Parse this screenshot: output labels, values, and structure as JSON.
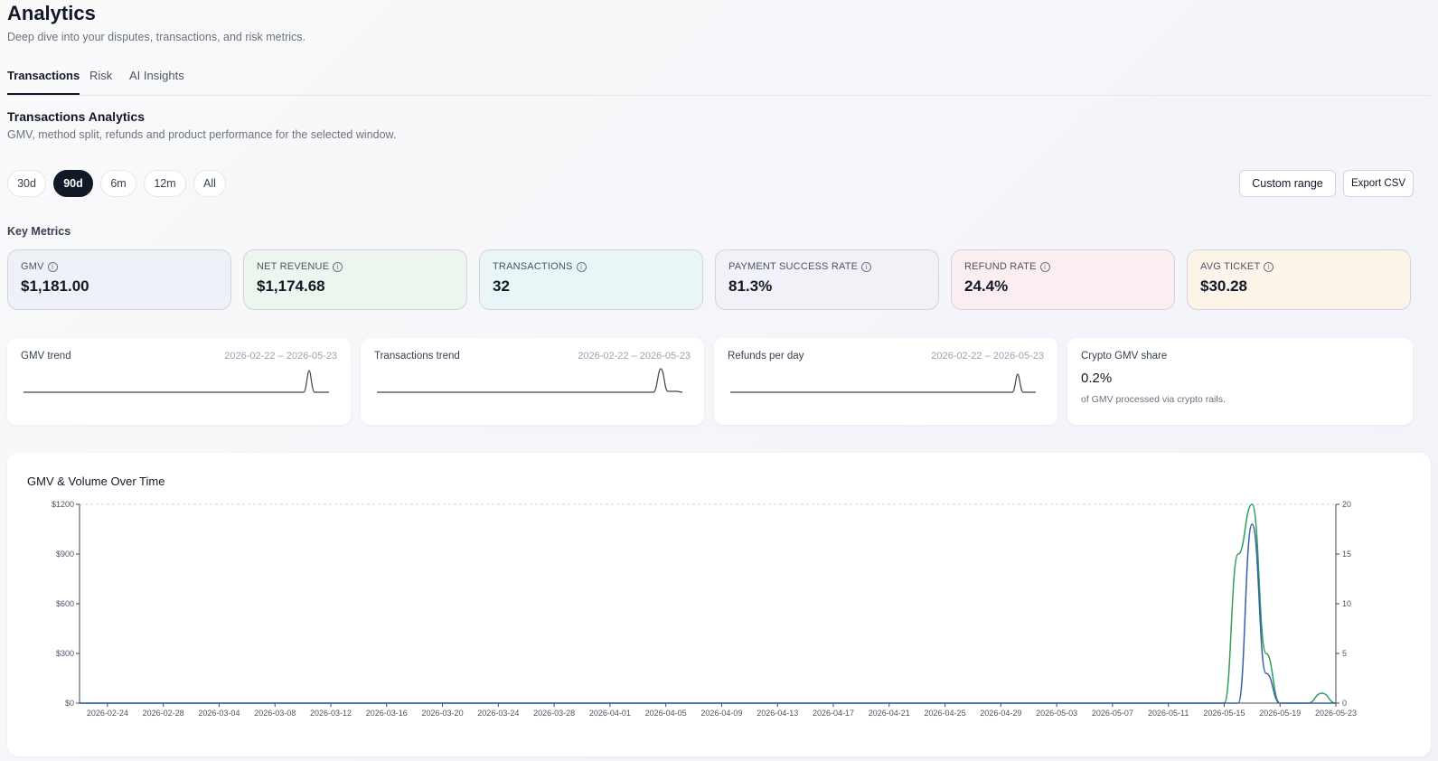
{
  "header": {
    "title": "Analytics",
    "subtitle": "Deep dive into your disputes, transactions, and risk metrics."
  },
  "tabs": [
    {
      "label": "Transactions",
      "active": true
    },
    {
      "label": "Risk",
      "active": false
    },
    {
      "label": "AI Insights",
      "active": false
    }
  ],
  "section": {
    "title": "Transactions Analytics",
    "subtitle": "GMV, method split, refunds and product performance for the selected window."
  },
  "ranges": [
    {
      "label": "30d",
      "active": false
    },
    {
      "label": "90d",
      "active": true
    },
    {
      "label": "6m",
      "active": false
    },
    {
      "label": "12m",
      "active": false
    },
    {
      "label": "All",
      "active": false
    }
  ],
  "actions": {
    "custom_range": "Custom range",
    "export_csv": "Export CSV"
  },
  "key_metrics": {
    "title": "Key Metrics",
    "items": [
      {
        "label": "GMV",
        "value": "$1,181.00",
        "bg": "#eef1f7"
      },
      {
        "label": "NET REVENUE",
        "value": "$1,174.68",
        "bg": "#edf5ef"
      },
      {
        "label": "TRANSACTIONS",
        "value": "32",
        "bg": "#eaf5f7"
      },
      {
        "label": "PAYMENT SUCCESS RATE",
        "value": "81.3%",
        "bg": "#f2f1f8"
      },
      {
        "label": "REFUND RATE",
        "value": "24.4%",
        "bg": "#fbeef1"
      },
      {
        "label": "AVG TICKET",
        "value": "$30.28",
        "bg": "#fcf4e9"
      }
    ]
  },
  "sparks": [
    {
      "title": "GMV trend",
      "dates": "2026-02-22 – 2026-05-23"
    },
    {
      "title": "Transactions trend",
      "dates": "2026-02-22 – 2026-05-23"
    },
    {
      "title": "Refunds per day",
      "dates": "2026-02-22 – 2026-05-23"
    }
  ],
  "crypto": {
    "title": "Crypto GMV share",
    "value": "0.2%",
    "sub": "of GMV processed via crypto rails."
  },
  "colors": {
    "gmv_line": "#2f9e5b",
    "volume_line": "#3a5fa8"
  },
  "chart_data": {
    "type": "line",
    "title": "GMV & Volume Over Time",
    "x_ticks": [
      "2026-02-24",
      "2026-02-28",
      "2026-03-04",
      "2026-03-08",
      "2026-03-12",
      "2026-03-16",
      "2026-03-20",
      "2026-03-24",
      "2026-03-28",
      "2026-04-01",
      "2026-04-05",
      "2026-04-09",
      "2026-04-13",
      "2026-04-17",
      "2026-04-21",
      "2026-04-25",
      "2026-04-29",
      "2026-05-03",
      "2026-05-07",
      "2026-05-11",
      "2026-05-15",
      "2026-05-19",
      "2026-05-23"
    ],
    "y_left": {
      "ticks": [
        "$0",
        "$300",
        "$600",
        "$900",
        "$1200"
      ],
      "range": [
        0,
        1200
      ]
    },
    "y_right": {
      "ticks": [
        "0",
        "5",
        "10",
        "15",
        "20"
      ],
      "range": [
        0,
        20
      ]
    },
    "grid": "top dashed line only",
    "series": [
      {
        "axis": "left",
        "points": [
          [
            "2026-02-22",
            0
          ],
          [
            "2026-05-15",
            0
          ],
          [
            "2026-05-16",
            900
          ],
          [
            "2026-05-17",
            1200
          ],
          [
            "2026-05-18",
            300
          ],
          [
            "2026-05-19",
            0
          ],
          [
            "2026-05-21",
            0
          ],
          [
            "2026-05-22",
            60
          ],
          [
            "2026-05-23",
            0
          ]
        ]
      },
      {
        "axis": "right",
        "points": [
          [
            "2026-02-22",
            0
          ],
          [
            "2026-05-16",
            0
          ],
          [
            "2026-05-17",
            18
          ],
          [
            "2026-05-18",
            3
          ],
          [
            "2026-05-19",
            0
          ],
          [
            "2026-05-23",
            0
          ]
        ]
      }
    ]
  }
}
